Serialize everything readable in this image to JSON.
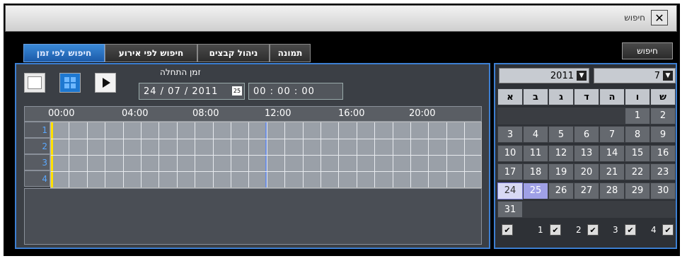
{
  "window": {
    "title": "חיפוש",
    "close_icon": "close-icon"
  },
  "tabs": [
    {
      "label": "חיפוש לפי זמן",
      "active": true
    },
    {
      "label": "חיפוש לפי אירוע",
      "active": false
    },
    {
      "label": "ניהול קבצים",
      "active": false
    },
    {
      "label": "תמונה",
      "active": false
    }
  ],
  "search_button": "חיפוש",
  "controls": {
    "single_view_icon": "single-view-icon",
    "quad_view_icon": "quad-view-icon",
    "play_icon": "play-icon"
  },
  "start_time": {
    "label": "זמן התחלה",
    "date": "24 / 07 / 2011",
    "calendar_icon_text": "25",
    "time": "00 : 00 : 00"
  },
  "timeline": {
    "ticks": [
      "00:00",
      "04:00",
      "08:00",
      "12:00",
      "16:00",
      "20:00"
    ],
    "channels": [
      "1",
      "2",
      "3",
      "4"
    ]
  },
  "calendar": {
    "year": "2011",
    "month": "7",
    "weekdays": [
      "ש",
      "ו",
      "ה",
      "ד",
      "ג",
      "ב",
      "א"
    ],
    "weeks": [
      [
        "2",
        "1",
        "",
        "",
        "",
        "",
        ""
      ],
      [
        "9",
        "8",
        "7",
        "6",
        "5",
        "4",
        "3"
      ],
      [
        "16",
        "15",
        "14",
        "13",
        "12",
        "11",
        "10"
      ],
      [
        "23",
        "22",
        "21",
        "20",
        "19",
        "18",
        "17"
      ],
      [
        "30",
        "29",
        "28",
        "27",
        "26",
        "25",
        "24"
      ],
      [
        "",
        "",
        "",
        "",
        "",
        "",
        "31"
      ]
    ],
    "today": "24",
    "selected": "25",
    "channel_checks": [
      "1",
      "2",
      "3",
      "4"
    ]
  },
  "colors": {
    "accent": "#3c7fd2",
    "active_tab": "#1c5aa8",
    "timeline_marker": "#ffe000"
  }
}
